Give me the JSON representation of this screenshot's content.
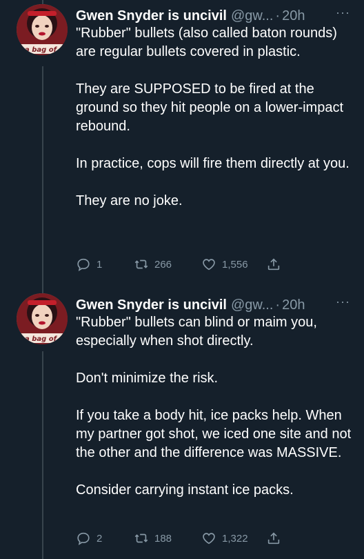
{
  "tweets": [
    {
      "name": "Gwen Snyder is uncivil",
      "handle": "@gw...",
      "separator": "·",
      "time": "20h",
      "more": "···",
      "avatar_text": "a bag of",
      "paragraphs": [
        "\"Rubber\" bullets (also called baton rounds) are regular bullets covered in plastic.",
        "They are SUPPOSED to be fired at the ground so they hit people on a lower-impact rebound.",
        "In practice, cops will fire them directly at you.",
        "They are no joke."
      ],
      "replies": "1",
      "retweets": "266",
      "likes": "1,556"
    },
    {
      "name": "Gwen Snyder is uncivil",
      "handle": "@gw...",
      "separator": "·",
      "time": "20h",
      "more": "···",
      "avatar_text": "a bag of",
      "paragraphs": [
        "\"Rubber\" bullets can blind or maim you, especially when shot directly.",
        "Don't minimize the risk.",
        "If you take a body hit, ice packs help. When my partner got shot, we iced one site and not the other and the difference was MASSIVE.",
        "Consider carrying instant ice packs."
      ],
      "replies": "2",
      "retweets": "188",
      "likes": "1,322"
    }
  ],
  "colors": {
    "background": "#15202b",
    "text": "#ffffff",
    "muted": "#8899a6",
    "thread_line": "#38444d"
  },
  "icons": [
    "reply-icon",
    "retweet-icon",
    "like-icon",
    "share-icon",
    "more-icon"
  ]
}
